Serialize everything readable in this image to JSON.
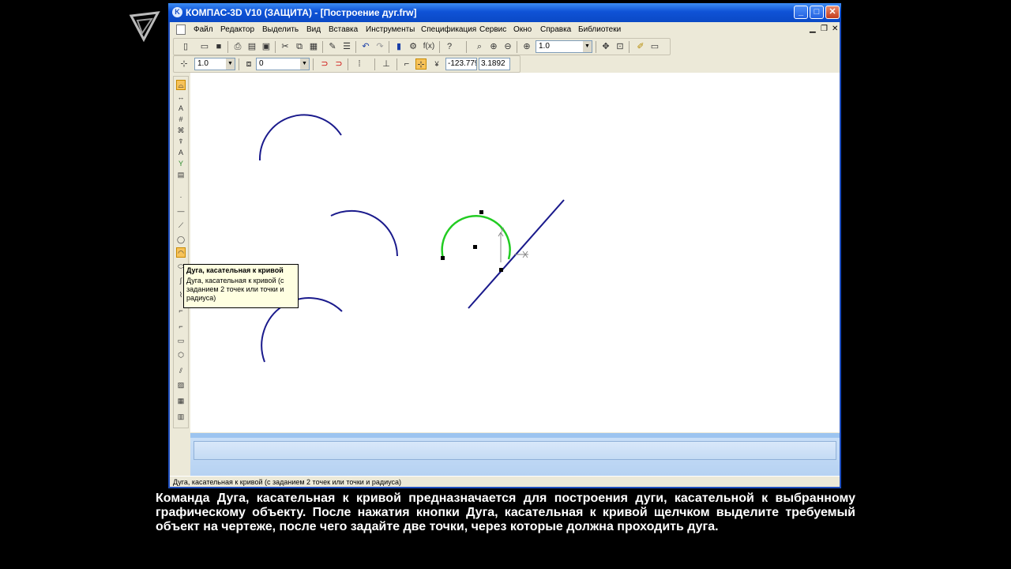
{
  "window": {
    "title": "КОМПАС-3D V10 (ЗАЩИТА) - [Построение дуг.frw]"
  },
  "menu": {
    "items": [
      "Файл",
      "Редактор",
      "Выделить",
      "Вид",
      "Вставка",
      "Инструменты",
      "Спецификация",
      "Сервис",
      "Окно",
      "Справка",
      "Библиотеки"
    ]
  },
  "toolbar_standard": {
    "zoom_value": "1.0"
  },
  "toolbar_current_state": {
    "step_value": "1.0",
    "layer_value": "0",
    "cursor_x": "-123.779",
    "cursor_y": "3.1892"
  },
  "tooltip": {
    "title": "Дуга, касательная к кривой",
    "description": "Дуга, касательная к кривой (с заданием 2 точек или точки и радиуса)"
  },
  "statusbar": {
    "text": "Дуга, касательная к кривой (с заданием 2 точек или точки и радиуса)"
  },
  "caption": {
    "text": "Команда Дуга, касательная к кривой предназначается для построения дуги, касательной к выбранному графическому объекту. После нажатия кнопки Дуга, касательная к кривой щелчком выделите требуемый объект на чертеже, после чего задайте две точки, через которые должна проходить дуга."
  },
  "drawing": {
    "colors": {
      "geometry": "#1a1a8c",
      "phantom": "#22cc22",
      "snap_point": "#000000"
    }
  },
  "icons": {
    "standard_toolbar": [
      "new-doc-icon",
      "open-icon",
      "save-icon",
      "print-icon",
      "preview-icon",
      "properties-icon",
      "cut-icon",
      "copy-icon",
      "paste-icon",
      "format-painter-icon",
      "manager-icon",
      "undo-icon",
      "redo-icon",
      "database-icon",
      "variables-icon",
      "fx-icon",
      "help-pointer-icon",
      "zoom-window-icon",
      "zoom-in-icon",
      "zoom-out-icon",
      "zoom-scale-icon",
      "pan-icon",
      "show-all-icon",
      "refresh-icon",
      "screen-icon"
    ],
    "vertical_toolbar": [
      "geometry-icon",
      "dimensions-icon",
      "designations-icon",
      "edit-icon",
      "parametrization-icon",
      "measure-icon",
      "select-icon",
      "spec-icon",
      "report-icon",
      "point-icon",
      "line-icon",
      "segment-icon",
      "circle-icon",
      "arc-tangent-icon",
      "ellipse-icon",
      "spline-icon",
      "polyline-icon",
      "chamfer-icon",
      "fillet-icon",
      "rectangle-icon",
      "polygon-icon",
      "contour-icon",
      "hatch-icon",
      "fill-icon",
      "view-icon"
    ]
  }
}
